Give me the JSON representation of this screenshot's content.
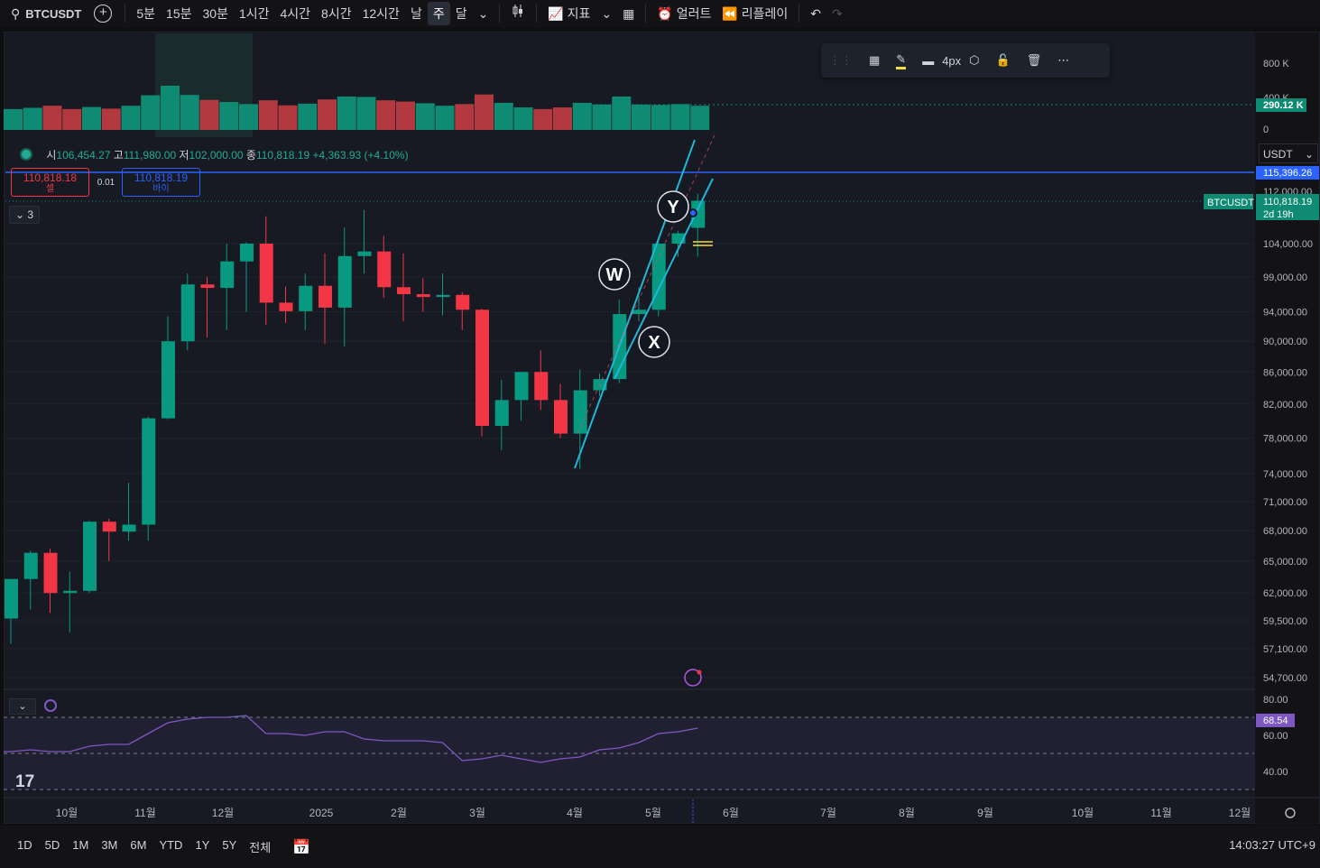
{
  "toolbar": {
    "symbol": "BTCUSDT",
    "intervals": [
      "5분",
      "15분",
      "30분",
      "1시간",
      "4시간",
      "8시간",
      "12시간",
      "날",
      "주",
      "달"
    ],
    "active_interval": "주",
    "indicators_label": "지표",
    "alert_label": "얼러트",
    "replay_label": "리플레이"
  },
  "legend": {
    "open_label": "시",
    "open": "106,454.27",
    "high_label": "고",
    "high": "111,980.00",
    "low_label": "저",
    "low": "102,000.00",
    "close_label": "종",
    "close": "110,818.19",
    "change": "+4,363.93 (+4.10%)"
  },
  "trade": {
    "sell_price": "110,818.18",
    "sell_label": "셀",
    "spread": "0.01",
    "buy_price": "110,818.19",
    "buy_label": "바이"
  },
  "collapse_label": "3",
  "drawing_toolbar": {
    "width_label": "4px"
  },
  "price_scale": {
    "currency": "USDT",
    "ticks": [
      "104,000.00",
      "99,000.00",
      "94,000.00",
      "90,000.00",
      "86,000.00",
      "82,000.00",
      "78,000.00",
      "74,000.00",
      "71,000.00",
      "68,000.00",
      "65,000.00",
      "62,000.00",
      "59,500.00",
      "57,100.00",
      "54,700.00"
    ],
    "line_price": "115,396.26",
    "partial_tick": "112,000.00",
    "last_symbol": "BTCUSDT",
    "last_price": "110,818.19",
    "countdown": "2d 19h"
  },
  "volume_scale": {
    "ticks": [
      "800 K",
      "400 K",
      "0"
    ],
    "current": "290.12 K"
  },
  "rsi_scale": {
    "ticks": [
      "80.00",
      "60.00",
      "40.00"
    ],
    "current": "68.54"
  },
  "time_axis": [
    "10월",
    "11월",
    "12월",
    "2025",
    "2월",
    "3월",
    "4월",
    "5월",
    "6월",
    "7월",
    "8월",
    "9월",
    "10월",
    "11월",
    "12월"
  ],
  "labels": {
    "w": "W",
    "x": "X",
    "y": "Y"
  },
  "ranges": [
    "1D",
    "5D",
    "1M",
    "3M",
    "6M",
    "YTD",
    "1Y",
    "5Y",
    "전체"
  ],
  "clock": "14:03:27 UTC+9",
  "colors": {
    "up": "#089981",
    "down": "#f23645",
    "channel": "#1fb6d8",
    "rsi": "#7e57c2",
    "price_line": "#2962ff"
  },
  "chart_data": {
    "type": "candlestick",
    "interval": "1W",
    "candles": [
      {
        "o": 59700,
        "h": 62500,
        "l": 57500,
        "c": 63300
      },
      {
        "o": 63300,
        "h": 66000,
        "l": 60500,
        "c": 65800
      },
      {
        "o": 65800,
        "h": 66200,
        "l": 60200,
        "c": 62000
      },
      {
        "o": 62000,
        "h": 64000,
        "l": 58500,
        "c": 62200
      },
      {
        "o": 62200,
        "h": 69000,
        "l": 62000,
        "c": 68900
      },
      {
        "o": 68900,
        "h": 69200,
        "l": 65000,
        "c": 67900
      },
      {
        "o": 67900,
        "h": 73000,
        "l": 67000,
        "c": 68600
      },
      {
        "o": 68600,
        "h": 80500,
        "l": 67000,
        "c": 80300
      },
      {
        "o": 80300,
        "h": 93400,
        "l": 80200,
        "c": 90000
      },
      {
        "o": 90000,
        "h": 99500,
        "l": 88800,
        "c": 97900
      },
      {
        "o": 97900,
        "h": 99000,
        "l": 90500,
        "c": 97400
      },
      {
        "o": 97400,
        "h": 104000,
        "l": 91500,
        "c": 101300
      },
      {
        "o": 101300,
        "h": 104200,
        "l": 94000,
        "c": 104000
      },
      {
        "o": 104000,
        "h": 108300,
        "l": 92200,
        "c": 95300
      },
      {
        "o": 95300,
        "h": 97600,
        "l": 92500,
        "c": 94100
      },
      {
        "o": 94100,
        "h": 99500,
        "l": 91500,
        "c": 97700
      },
      {
        "o": 97700,
        "h": 102500,
        "l": 89700,
        "c": 94600
      },
      {
        "o": 94600,
        "h": 106500,
        "l": 89300,
        "c": 102100
      },
      {
        "o": 102100,
        "h": 109300,
        "l": 99500,
        "c": 102800
      },
      {
        "o": 102800,
        "h": 105200,
        "l": 96000,
        "c": 97500
      },
      {
        "o": 97500,
        "h": 102500,
        "l": 92700,
        "c": 96500
      },
      {
        "o": 96500,
        "h": 98800,
        "l": 94000,
        "c": 96100
      },
      {
        "o": 96100,
        "h": 99500,
        "l": 93500,
        "c": 96400
      },
      {
        "o": 96400,
        "h": 96800,
        "l": 91500,
        "c": 94300
      },
      {
        "o": 94300,
        "h": 94400,
        "l": 78200,
        "c": 79400
      },
      {
        "o": 79400,
        "h": 85000,
        "l": 76600,
        "c": 82500
      },
      {
        "o": 82500,
        "h": 86000,
        "l": 80000,
        "c": 86000
      },
      {
        "o": 86000,
        "h": 88800,
        "l": 81300,
        "c": 82500
      },
      {
        "o": 82500,
        "h": 84500,
        "l": 78000,
        "c": 78500
      },
      {
        "o": 78500,
        "h": 86300,
        "l": 74500,
        "c": 83700
      },
      {
        "o": 83700,
        "h": 85800,
        "l": 83000,
        "c": 85100
      },
      {
        "o": 85100,
        "h": 95700,
        "l": 84600,
        "c": 93700
      },
      {
        "o": 93700,
        "h": 97500,
        "l": 92700,
        "c": 94300
      },
      {
        "o": 94300,
        "h": 104500,
        "l": 93400,
        "c": 104000
      },
      {
        "o": 104000,
        "h": 106000,
        "l": 102000,
        "c": 105600
      },
      {
        "o": 106454.27,
        "h": 111980,
        "l": 102000,
        "c": 110818.19
      }
    ],
    "volume": [
      250,
      265,
      290,
      250,
      275,
      255,
      290,
      415,
      530,
      420,
      360,
      335,
      310,
      355,
      295,
      315,
      365,
      400,
      395,
      355,
      340,
      320,
      290,
      310,
      425,
      325,
      270,
      250,
      270,
      325,
      305,
      400,
      305,
      300,
      310,
      290
    ],
    "volume_up": [
      true,
      true,
      false,
      false,
      true,
      false,
      true,
      true,
      true,
      true,
      false,
      true,
      true,
      false,
      false,
      true,
      false,
      true,
      true,
      false,
      false,
      true,
      true,
      false,
      false,
      true,
      true,
      false,
      false,
      true,
      true,
      true,
      true,
      true,
      true,
      true
    ],
    "rsi": [
      51,
      52,
      51,
      51,
      54,
      55,
      55,
      61,
      67,
      69,
      70,
      70,
      71,
      61,
      61,
      60,
      62,
      62,
      58,
      57,
      57,
      57,
      56,
      46,
      47,
      49,
      47,
      45,
      47,
      48,
      52,
      53,
      56,
      61,
      62,
      64
    ]
  }
}
